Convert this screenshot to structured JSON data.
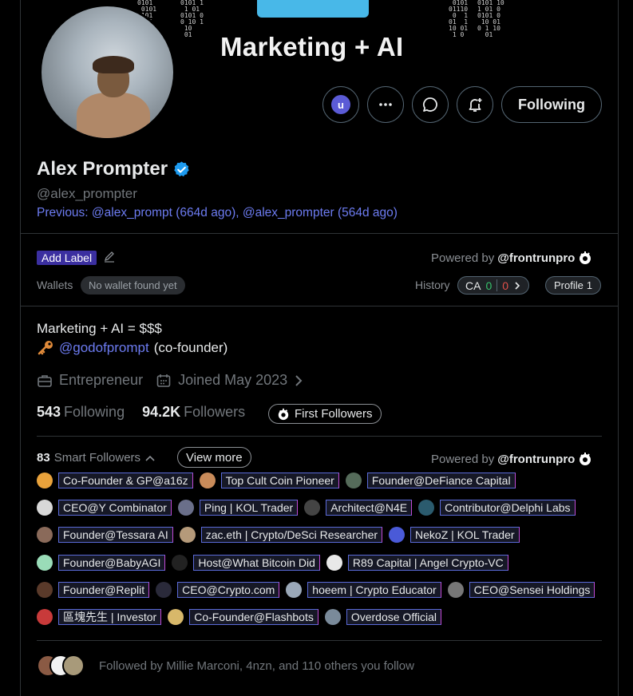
{
  "banner": {
    "title": "Marketing + AI"
  },
  "profile": {
    "name": "Alex Prompter",
    "handle": "@alex_prompter",
    "previous": "Previous: @alex_prompt (664d ago), @alex_prompter (564d ago)"
  },
  "actions": {
    "badge_letter": "u",
    "following_label": "Following"
  },
  "labels": {
    "add_label": "Add Label",
    "powered_by": "Powered by",
    "powered_handle": "@frontrunpro",
    "wallets": "Wallets",
    "no_wallet": "No wallet found yet",
    "history": "History",
    "ca_label": "CA",
    "ca_green": "0",
    "ca_red": "0",
    "profile_label": "Profile",
    "profile_count": "1"
  },
  "bio": {
    "line1": "Marketing + AI = $$$",
    "link": "@godofprompt",
    "suffix": "(co-founder)",
    "occupation": "Entrepreneur",
    "joined": "Joined May 2023"
  },
  "stats": {
    "following_count": "543",
    "following_label": "Following",
    "followers_count": "94.2K",
    "followers_label": "Followers",
    "first_followers": "First Followers"
  },
  "smart_followers": {
    "count": "83",
    "label": "Smart Followers",
    "view_more": "View more",
    "rows": [
      [
        {
          "tag": "Co-Founder & GP@a16z",
          "color": "#e9a23b"
        },
        {
          "tag": "Top Cult Coin Pioneer",
          "color": "#c98b5a"
        },
        {
          "tag": "Founder@DeFiance Capital",
          "color": "#556b5a"
        }
      ],
      [
        {
          "tag": "CEO@Y Combinator",
          "color": "#d8d8d8"
        },
        {
          "tag": "Ping | KOL Trader",
          "color": "#6a6f8a"
        },
        {
          "tag": "Architect@N4E",
          "color": "#444"
        },
        {
          "tag": "Contributor@Delphi Labs",
          "color": "#2b5b6e"
        }
      ],
      [
        {
          "tag": "Founder@Tessara AI",
          "color": "#8a6a5a"
        },
        {
          "tag": "zac.eth | Crypto/DeSci Researcher",
          "color": "#b59a7a"
        },
        {
          "tag": "NekoZ | KOL Trader",
          "color": "#4a5ad8"
        }
      ],
      [
        {
          "tag": "Founder@BabyAGI",
          "color": "#9adcb8"
        },
        {
          "tag": "Host@What Bitcoin Did",
          "color": "#222"
        },
        {
          "tag": "R89 Capital | Angel Crypto-VC",
          "color": "#e8e8e8"
        }
      ],
      [
        {
          "tag": "Founder@Replit",
          "color": "#5a3a2a"
        },
        {
          "tag": "CEO@Crypto.com",
          "color": "#2a2a3a"
        },
        {
          "tag": "hoeem | Crypto Educator",
          "color": "#9aa8b8"
        },
        {
          "tag": "CEO@Sensei Holdings",
          "color": "#777"
        }
      ],
      [
        {
          "tag": "區塊先生 | Investor",
          "color": "#c83a3a"
        },
        {
          "tag": "Co-Founder@Flashbots",
          "color": "#d8b86a"
        },
        {
          "tag": "Overdose Official",
          "color": "#7a8a9a"
        }
      ]
    ]
  },
  "followed_by": "Followed by Millie Marconi, 4nzn, and 110 others you follow"
}
